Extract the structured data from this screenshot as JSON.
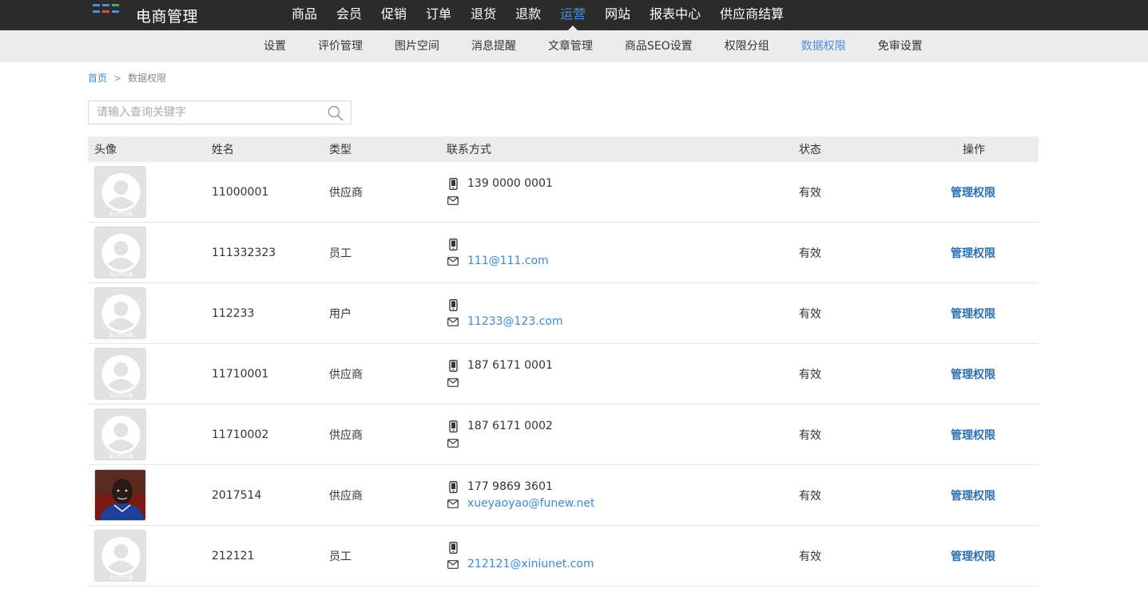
{
  "brand": {
    "name": "电商管理",
    "logo_colors": [
      "#4a90e2",
      "#4a90e2",
      "#3cb371",
      "#4a90e2",
      "#e04a4a",
      "#4a90e2"
    ]
  },
  "main_nav": {
    "items": [
      "商品",
      "会员",
      "促销",
      "订单",
      "退货",
      "退款",
      "运营",
      "网站",
      "报表中心",
      "供应商结算"
    ],
    "active": "运营"
  },
  "sub_nav": {
    "items": [
      "设置",
      "评价管理",
      "图片空间",
      "消息提醒",
      "文章管理",
      "商品SEO设置",
      "权限分组",
      "数据权限",
      "免审设置"
    ],
    "active": "数据权限"
  },
  "breadcrumb": {
    "home": "首页",
    "separator": ">",
    "current": "数据权限"
  },
  "search": {
    "placeholder": "请输入查询关键字",
    "value": ""
  },
  "table": {
    "headers": {
      "avatar": "头像",
      "name": "姓名",
      "type": "类型",
      "contact": "联系方式",
      "status": "状态",
      "op": "操作"
    },
    "rows": [
      {
        "name": "11000001",
        "type": "供应商",
        "phone": "139 0000 0001",
        "email": "",
        "status": "有效",
        "op": "管理权限",
        "avatar": "placeholder"
      },
      {
        "name": "111332323",
        "type": "员工",
        "phone": "",
        "email": "111@111.com",
        "status": "有效",
        "op": "管理权限",
        "avatar": "placeholder"
      },
      {
        "name": "112233",
        "type": "用户",
        "phone": "",
        "email": "11233@123.com",
        "status": "有效",
        "op": "管理权限",
        "avatar": "placeholder"
      },
      {
        "name": "11710001",
        "type": "供应商",
        "phone": "187 6171 0001",
        "email": "",
        "status": "有效",
        "op": "管理权限",
        "avatar": "placeholder"
      },
      {
        "name": "11710002",
        "type": "供应商",
        "phone": "187 6171 0002",
        "email": "",
        "status": "有效",
        "op": "管理权限",
        "avatar": "placeholder"
      },
      {
        "name": "2017514",
        "type": "供应商",
        "phone": "177 9869 3601",
        "email": "xueyaoyao@funew.net",
        "status": "有效",
        "op": "管理权限",
        "avatar": "photo"
      },
      {
        "name": "212121",
        "type": "员工",
        "phone": "",
        "email": "212121@xiniunet.com",
        "status": "有效",
        "op": "管理权限",
        "avatar": "placeholder"
      }
    ],
    "placeholder_avatar_text": "未上传头像"
  },
  "icons": {
    "search": "search-icon",
    "phone": "phone-icon",
    "mail": "mail-icon"
  }
}
